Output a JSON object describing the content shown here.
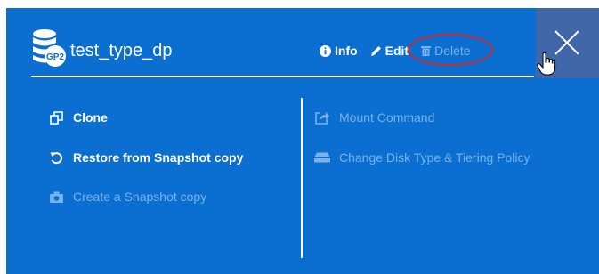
{
  "volume": {
    "name": "test_type_dp",
    "disk_type_badge": "GP2"
  },
  "header_actions": {
    "info": {
      "label": "Info",
      "icon": "info-circle-icon"
    },
    "edit": {
      "label": "Edit",
      "icon": "pencil-icon"
    },
    "delete": {
      "label": "Delete",
      "icon": "trash-icon",
      "enabled": false
    }
  },
  "left_actions": [
    {
      "label": "Clone",
      "icon": "clone-icon",
      "enabled": true
    },
    {
      "label": "Restore from Snapshot copy",
      "icon": "restore-icon",
      "enabled": true
    },
    {
      "label": "Create a Snapshot copy",
      "icon": "camera-icon",
      "enabled": false
    }
  ],
  "right_actions": [
    {
      "label": "Mount Command",
      "icon": "share-icon",
      "enabled": false
    },
    {
      "label": "Change Disk Type & Tiering Policy",
      "icon": "disk-icon",
      "enabled": false
    }
  ],
  "colors": {
    "panel_bg": "#0a6fd1",
    "close_box_bg": "#3f67a9",
    "disabled_text": "#79b1ea",
    "annotation": "#d8262a"
  }
}
